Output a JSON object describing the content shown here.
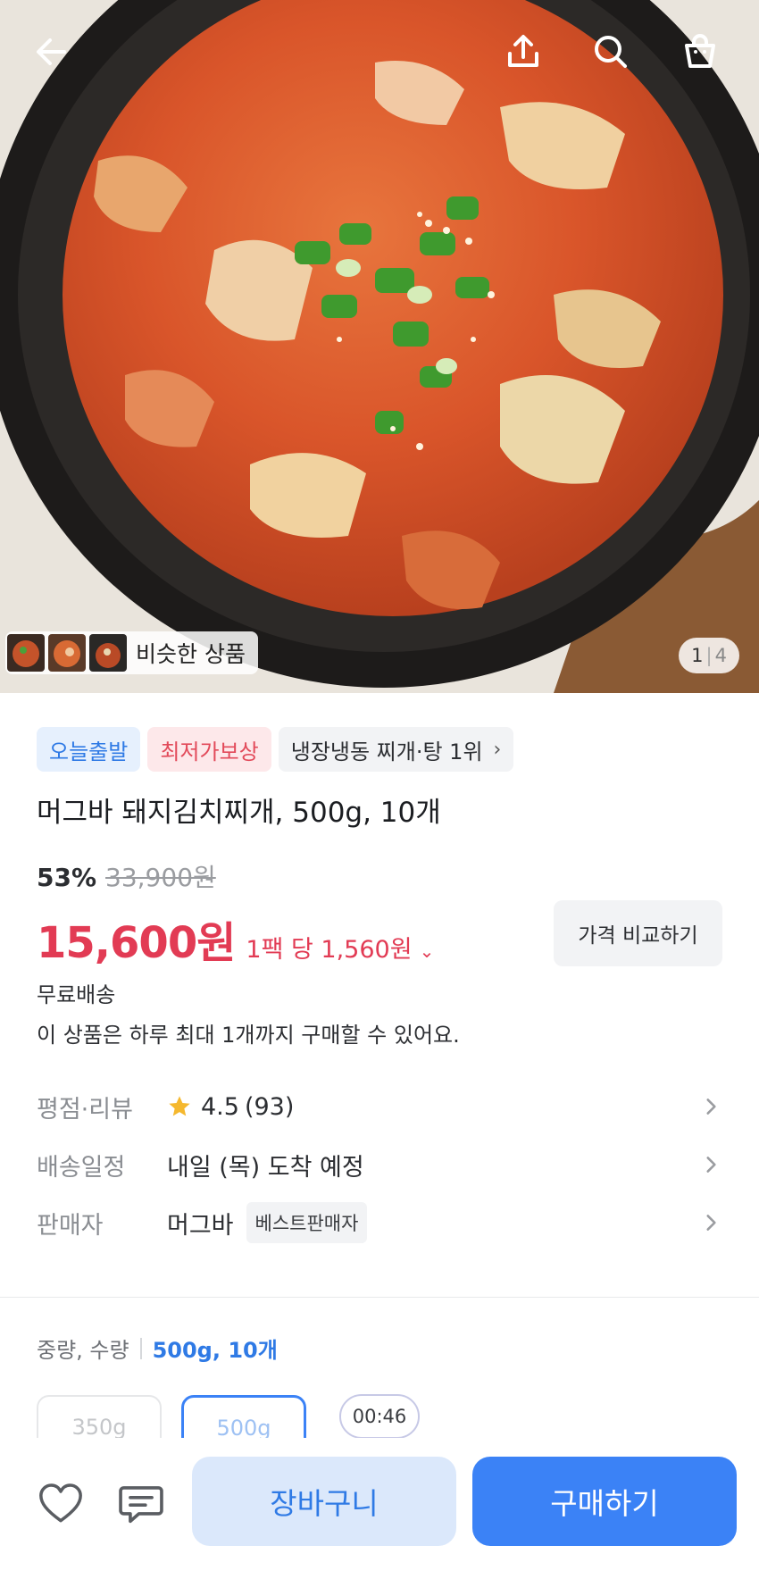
{
  "header": {
    "back_icon": "arrow-left-icon",
    "share_icon": "share-upload-icon",
    "search_icon": "search-icon",
    "cart_icon": "shopping-bag-icon"
  },
  "gallery": {
    "similar_label": "비슷한 상품",
    "current": "1",
    "separator": "|",
    "total": "4"
  },
  "badges": {
    "today_ship": "오늘출발",
    "lowest_price": "최저가보상",
    "ranking": "냉장냉동 찌개·탕 1위"
  },
  "product": {
    "title": "머그바 돼지김치찌개, 500g, 10개",
    "discount": "53%",
    "original_price": "33,900원",
    "price": "15,600원",
    "unit_price": "1팩 당 1,560원",
    "compare_label": "가격 비교하기",
    "shipping": "무료배송",
    "purchase_limit": "이 상품은 하루 최대 1개까지 구매할 수 있어요."
  },
  "info_rows": {
    "rating_key": "평점·리뷰",
    "rating_value": "4.5",
    "review_count": "(93)",
    "delivery_key": "배송일정",
    "delivery_value": "내일 (목) 도착 예정",
    "seller_key": "판매자",
    "seller_value": "머그바",
    "seller_badge": "베스트판매자"
  },
  "options": {
    "label": "중량, 수량",
    "selected": "500g, 10개",
    "option_a": "350g",
    "option_b": "500g",
    "timer": "00:46"
  },
  "bottom_bar": {
    "wishlist_icon": "heart-icon",
    "inquiry_icon": "chat-icon",
    "cart_label": "장바구니",
    "buy_label": "구매하기"
  },
  "colors": {
    "accent_blue": "#3b82f6",
    "price_red": "#e23b54",
    "star": "#f5b82e"
  }
}
